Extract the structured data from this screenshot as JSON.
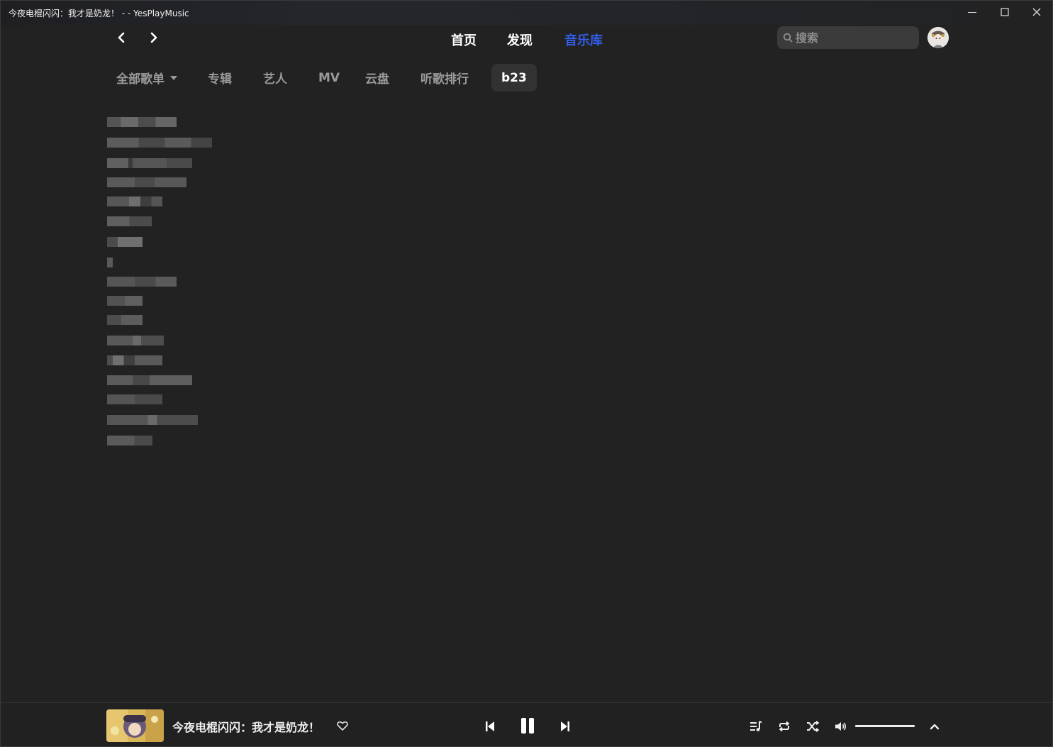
{
  "window": {
    "title": "今夜电棍闪闪：我才是奶龙！ - - YesPlayMusic"
  },
  "nav": {
    "tabs": [
      {
        "label": "首页",
        "active": false
      },
      {
        "label": "发现",
        "active": false
      },
      {
        "label": "音乐库",
        "active": true
      }
    ],
    "search": {
      "placeholder": "搜索",
      "value": ""
    }
  },
  "library": {
    "tabs": [
      {
        "label": "全部歌单",
        "active": false,
        "has_dropdown": true
      },
      {
        "label": "专辑",
        "active": false
      },
      {
        "label": "艺人",
        "active": false
      },
      {
        "label": "MV",
        "active": false
      },
      {
        "label": "云盘",
        "active": false
      },
      {
        "label": "听歌排行",
        "active": false
      },
      {
        "label": "b23",
        "active": true
      }
    ],
    "playlist_count_visible": 17
  },
  "player": {
    "track_title": "今夜电棍闪闪：我才是奶龙！",
    "is_playing": true,
    "liked": false,
    "volume_percent": 100
  },
  "colors": {
    "background": "#222222",
    "accent": "#335eea",
    "tab_active_bg": "#323232",
    "text_primary": "#ffffff",
    "text_muted": "#9a9a9a"
  }
}
